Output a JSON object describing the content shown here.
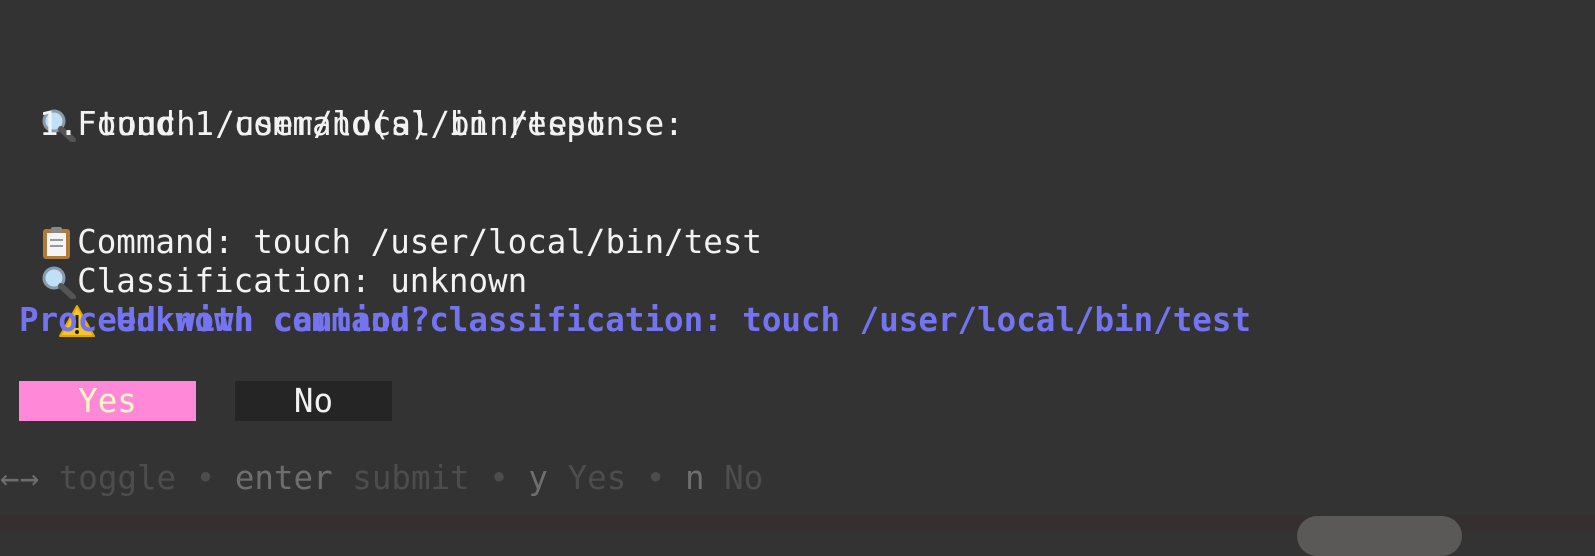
{
  "found": {
    "icon": "magnifier-icon",
    "emoji": "🔍",
    "text": "Found 1 command(s) in response:"
  },
  "commands": [
    "  1. touch /user/local/bin/test"
  ],
  "command_line": {
    "icon": "clipboard-icon",
    "emoji": "📋",
    "text": "Command: touch /user/local/bin/test"
  },
  "classification_line": {
    "icon": "magnifier-icon",
    "emoji": "🔍",
    "text": "Classification: unknown"
  },
  "warning": {
    "icon": "warning-icon",
    "emoji": "⚠️",
    "text": "Unknown command classification: touch /user/local/bin/test",
    "question": "Proceed with caution?",
    "color": "#7474f0"
  },
  "buttons": {
    "yes": "Yes",
    "no": "No",
    "selected": "Yes",
    "selected_bg": "#ff88d8"
  },
  "help": {
    "arrows": "←→",
    "toggle": "toggle",
    "sep": "•",
    "enter_key": "enter",
    "enter_desc": "submit",
    "y_key": "y",
    "y_desc": "Yes",
    "n_key": "n",
    "n_desc": "No"
  }
}
